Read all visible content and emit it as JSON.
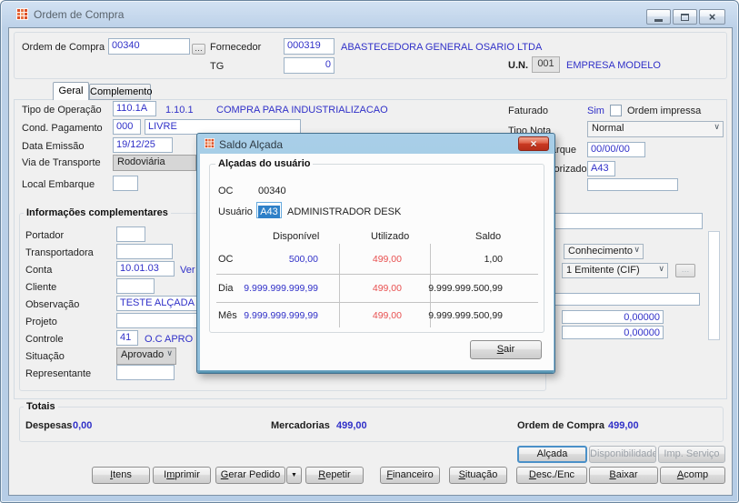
{
  "window": {
    "title": "Ordem de Compra"
  },
  "icons": {
    "lookup": "…",
    "more": "…",
    "dropdown_arrow": "▼"
  },
  "colors": {
    "value_blue": "#3030c8",
    "alert_red": "#e85050",
    "selection_blue": "#2e80c8"
  },
  "header": {
    "order_label": "Ordem de Compra",
    "order_value": "00340",
    "supplier_label": "Fornecedor",
    "supplier_code": "000319",
    "supplier_name": "ABASTECEDORA GENERAL OSARIO LTDA",
    "tg_label": "TG",
    "tg_value": "0",
    "un_label": "U.N.",
    "un_value": "001",
    "un_name": "EMPRESA MODELO"
  },
  "tabs": {
    "geral": "Geral",
    "complemento": "Complemento"
  },
  "geral": {
    "tipo_operacao": {
      "label": "Tipo de Operação",
      "code": "110.1A",
      "sub": "1.10.1",
      "desc": "COMPRA PARA INDUSTRIALIZACAO"
    },
    "cond_pagamento": {
      "label": "Cond. Pagamento",
      "code": "000",
      "desc": "LIVRE"
    },
    "data_emissao": {
      "label": "Data Emissão",
      "value": "19/12/25"
    },
    "via_transporte": {
      "label": "Via de Transporte",
      "value": "Rodoviária"
    },
    "local_embarque": {
      "label": "Local Embarque"
    },
    "faturado": {
      "label": "Faturado",
      "value": "Sim"
    },
    "ordem_impressa": {
      "label": "Ordem impressa"
    },
    "tipo_nota": {
      "label": "Tipo Nota",
      "value": "Normal"
    },
    "data_embarque": {
      "label": "Data Embarque",
      "value": "00/00/00"
    },
    "autorizado": {
      "label": "Autorizado",
      "value": "A43"
    },
    "conhecimento": {
      "value": "Conhecimento"
    },
    "emitente": {
      "value": "1 Emitente (CIF)"
    },
    "num1": "0,00000",
    "num2": "0,00000"
  },
  "info_comp": {
    "title": "Informações complementares",
    "portador_label": "Portador",
    "transportadora_label": "Transportadora",
    "conta": {
      "label": "Conta",
      "value": "10.01.03",
      "desc": "Ver"
    },
    "cliente_label": "Cliente",
    "observacao": {
      "label": "Observação",
      "value": "TESTE ALÇADA A"
    },
    "projeto_label": "Projeto",
    "controle": {
      "label": "Controle",
      "value": "41",
      "desc": "O.C APRO"
    },
    "situacao": {
      "label": "Situação",
      "value": "Aprovado"
    },
    "representante_label": "Representante"
  },
  "dialog": {
    "title": "Saldo Alçada",
    "group_title": "Alçadas do usuário",
    "oc_label": "OC",
    "oc_value": "00340",
    "user_label": "Usuário",
    "user_code": "A43",
    "user_name": "ADMINISTRADOR DESK",
    "table": {
      "headers": [
        "Disponível",
        "Utilizado",
        "Saldo"
      ],
      "rows": [
        {
          "label": "OC",
          "disponivel": "500,00",
          "utilizado": "499,00",
          "saldo": "1,00"
        },
        {
          "label": "Dia",
          "disponivel": "9.999.999.999,99",
          "utilizado": "499,00",
          "saldo": "9.999.999.500,99"
        },
        {
          "label": "Mês",
          "disponivel": "9.999.999.999,99",
          "utilizado": "499,00",
          "saldo": "9.999.999.500,99"
        }
      ]
    },
    "exit_button": {
      "label": "Sair",
      "accel": "S"
    }
  },
  "totals": {
    "title": "Totais",
    "despesas_label": "Despesas",
    "despesas_value": "0,00",
    "mercadorias_label": "Mercadorias",
    "mercadorias_value": "499,00",
    "ordem_label": "Ordem de Compra",
    "ordem_value": "499,00"
  },
  "buttons": {
    "alcada": {
      "label": "Alçada"
    },
    "disponibilidade": {
      "label": "Disponibilidade"
    },
    "imp_servico": {
      "label": "Imp. Serviço"
    },
    "itens": {
      "label": "Itens",
      "accel": "I"
    },
    "imprimir": {
      "label": "Imprimir",
      "accel": "m"
    },
    "gerar_pedido": {
      "label": "Gerar Pedido",
      "accel": "G"
    },
    "repetir": {
      "label": "Repetir",
      "accel": "R"
    },
    "financeiro": {
      "label": "Financeiro",
      "accel": "F"
    },
    "situacao": {
      "label": "Situação",
      "accel": "S"
    },
    "desc_enc": {
      "label": "Desc./Enc",
      "accel": "D"
    },
    "baixar": {
      "label": "Baixar",
      "accel": "B"
    },
    "acomp": {
      "label": "Acomp",
      "accel": "A"
    }
  }
}
